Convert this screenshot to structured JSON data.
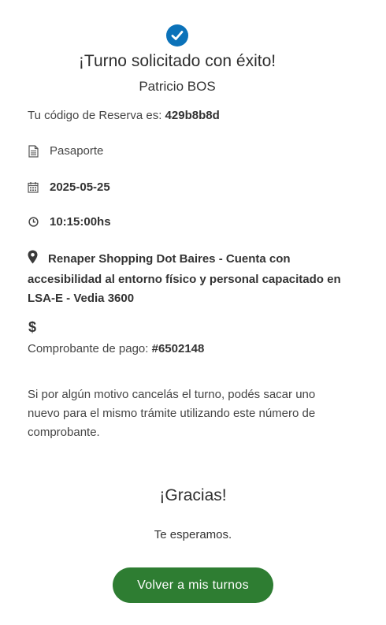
{
  "title": "¡Turno solicitado con éxito!",
  "person_name": "Patricio BOS",
  "reservation": {
    "label": "Tu código de Reserva es:",
    "code": "429b8b8d"
  },
  "details": {
    "procedure": "Pasaporte",
    "date": "2025-05-25",
    "time": "10:15:00hs",
    "location": "Renaper Shopping Dot Baires - Cuenta con accesibilidad al entorno físico y personal capacitado en LSA-E - Vedia 3600",
    "dollar_symbol": "$"
  },
  "receipt": {
    "label": "Comprobante de pago:",
    "number": "#6502148"
  },
  "notice": "Si por algún motivo cancelás el turno, podés sacar uno nuevo para el mismo trámite utilizando este número de comprobante.",
  "thanks": "¡Gracias!",
  "wait": "Te esperamos.",
  "back_button": "Volver a mis turnos",
  "colors": {
    "success_icon": "#0b72b9",
    "button": "#2e7d32"
  }
}
